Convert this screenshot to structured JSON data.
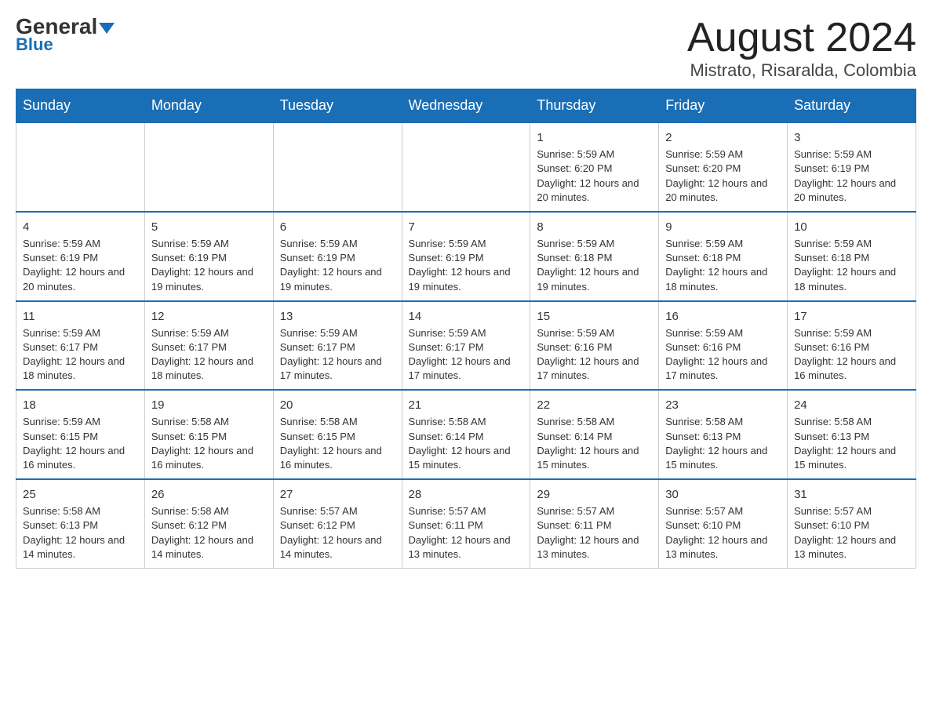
{
  "header": {
    "logo_general": "General",
    "logo_blue": "Blue",
    "title": "August 2024",
    "subtitle": "Mistrato, Risaralda, Colombia"
  },
  "days_of_week": [
    "Sunday",
    "Monday",
    "Tuesday",
    "Wednesday",
    "Thursday",
    "Friday",
    "Saturday"
  ],
  "weeks": [
    {
      "cells": [
        {
          "day": "",
          "info": ""
        },
        {
          "day": "",
          "info": ""
        },
        {
          "day": "",
          "info": ""
        },
        {
          "day": "",
          "info": ""
        },
        {
          "day": "1",
          "info": "Sunrise: 5:59 AM\nSunset: 6:20 PM\nDaylight: 12 hours and 20 minutes."
        },
        {
          "day": "2",
          "info": "Sunrise: 5:59 AM\nSunset: 6:20 PM\nDaylight: 12 hours and 20 minutes."
        },
        {
          "day": "3",
          "info": "Sunrise: 5:59 AM\nSunset: 6:19 PM\nDaylight: 12 hours and 20 minutes."
        }
      ]
    },
    {
      "cells": [
        {
          "day": "4",
          "info": "Sunrise: 5:59 AM\nSunset: 6:19 PM\nDaylight: 12 hours and 20 minutes."
        },
        {
          "day": "5",
          "info": "Sunrise: 5:59 AM\nSunset: 6:19 PM\nDaylight: 12 hours and 19 minutes."
        },
        {
          "day": "6",
          "info": "Sunrise: 5:59 AM\nSunset: 6:19 PM\nDaylight: 12 hours and 19 minutes."
        },
        {
          "day": "7",
          "info": "Sunrise: 5:59 AM\nSunset: 6:19 PM\nDaylight: 12 hours and 19 minutes."
        },
        {
          "day": "8",
          "info": "Sunrise: 5:59 AM\nSunset: 6:18 PM\nDaylight: 12 hours and 19 minutes."
        },
        {
          "day": "9",
          "info": "Sunrise: 5:59 AM\nSunset: 6:18 PM\nDaylight: 12 hours and 18 minutes."
        },
        {
          "day": "10",
          "info": "Sunrise: 5:59 AM\nSunset: 6:18 PM\nDaylight: 12 hours and 18 minutes."
        }
      ]
    },
    {
      "cells": [
        {
          "day": "11",
          "info": "Sunrise: 5:59 AM\nSunset: 6:17 PM\nDaylight: 12 hours and 18 minutes."
        },
        {
          "day": "12",
          "info": "Sunrise: 5:59 AM\nSunset: 6:17 PM\nDaylight: 12 hours and 18 minutes."
        },
        {
          "day": "13",
          "info": "Sunrise: 5:59 AM\nSunset: 6:17 PM\nDaylight: 12 hours and 17 minutes."
        },
        {
          "day": "14",
          "info": "Sunrise: 5:59 AM\nSunset: 6:17 PM\nDaylight: 12 hours and 17 minutes."
        },
        {
          "day": "15",
          "info": "Sunrise: 5:59 AM\nSunset: 6:16 PM\nDaylight: 12 hours and 17 minutes."
        },
        {
          "day": "16",
          "info": "Sunrise: 5:59 AM\nSunset: 6:16 PM\nDaylight: 12 hours and 17 minutes."
        },
        {
          "day": "17",
          "info": "Sunrise: 5:59 AM\nSunset: 6:16 PM\nDaylight: 12 hours and 16 minutes."
        }
      ]
    },
    {
      "cells": [
        {
          "day": "18",
          "info": "Sunrise: 5:59 AM\nSunset: 6:15 PM\nDaylight: 12 hours and 16 minutes."
        },
        {
          "day": "19",
          "info": "Sunrise: 5:58 AM\nSunset: 6:15 PM\nDaylight: 12 hours and 16 minutes."
        },
        {
          "day": "20",
          "info": "Sunrise: 5:58 AM\nSunset: 6:15 PM\nDaylight: 12 hours and 16 minutes."
        },
        {
          "day": "21",
          "info": "Sunrise: 5:58 AM\nSunset: 6:14 PM\nDaylight: 12 hours and 15 minutes."
        },
        {
          "day": "22",
          "info": "Sunrise: 5:58 AM\nSunset: 6:14 PM\nDaylight: 12 hours and 15 minutes."
        },
        {
          "day": "23",
          "info": "Sunrise: 5:58 AM\nSunset: 6:13 PM\nDaylight: 12 hours and 15 minutes."
        },
        {
          "day": "24",
          "info": "Sunrise: 5:58 AM\nSunset: 6:13 PM\nDaylight: 12 hours and 15 minutes."
        }
      ]
    },
    {
      "cells": [
        {
          "day": "25",
          "info": "Sunrise: 5:58 AM\nSunset: 6:13 PM\nDaylight: 12 hours and 14 minutes."
        },
        {
          "day": "26",
          "info": "Sunrise: 5:58 AM\nSunset: 6:12 PM\nDaylight: 12 hours and 14 minutes."
        },
        {
          "day": "27",
          "info": "Sunrise: 5:57 AM\nSunset: 6:12 PM\nDaylight: 12 hours and 14 minutes."
        },
        {
          "day": "28",
          "info": "Sunrise: 5:57 AM\nSunset: 6:11 PM\nDaylight: 12 hours and 13 minutes."
        },
        {
          "day": "29",
          "info": "Sunrise: 5:57 AM\nSunset: 6:11 PM\nDaylight: 12 hours and 13 minutes."
        },
        {
          "day": "30",
          "info": "Sunrise: 5:57 AM\nSunset: 6:10 PM\nDaylight: 12 hours and 13 minutes."
        },
        {
          "day": "31",
          "info": "Sunrise: 5:57 AM\nSunset: 6:10 PM\nDaylight: 12 hours and 13 minutes."
        }
      ]
    }
  ]
}
